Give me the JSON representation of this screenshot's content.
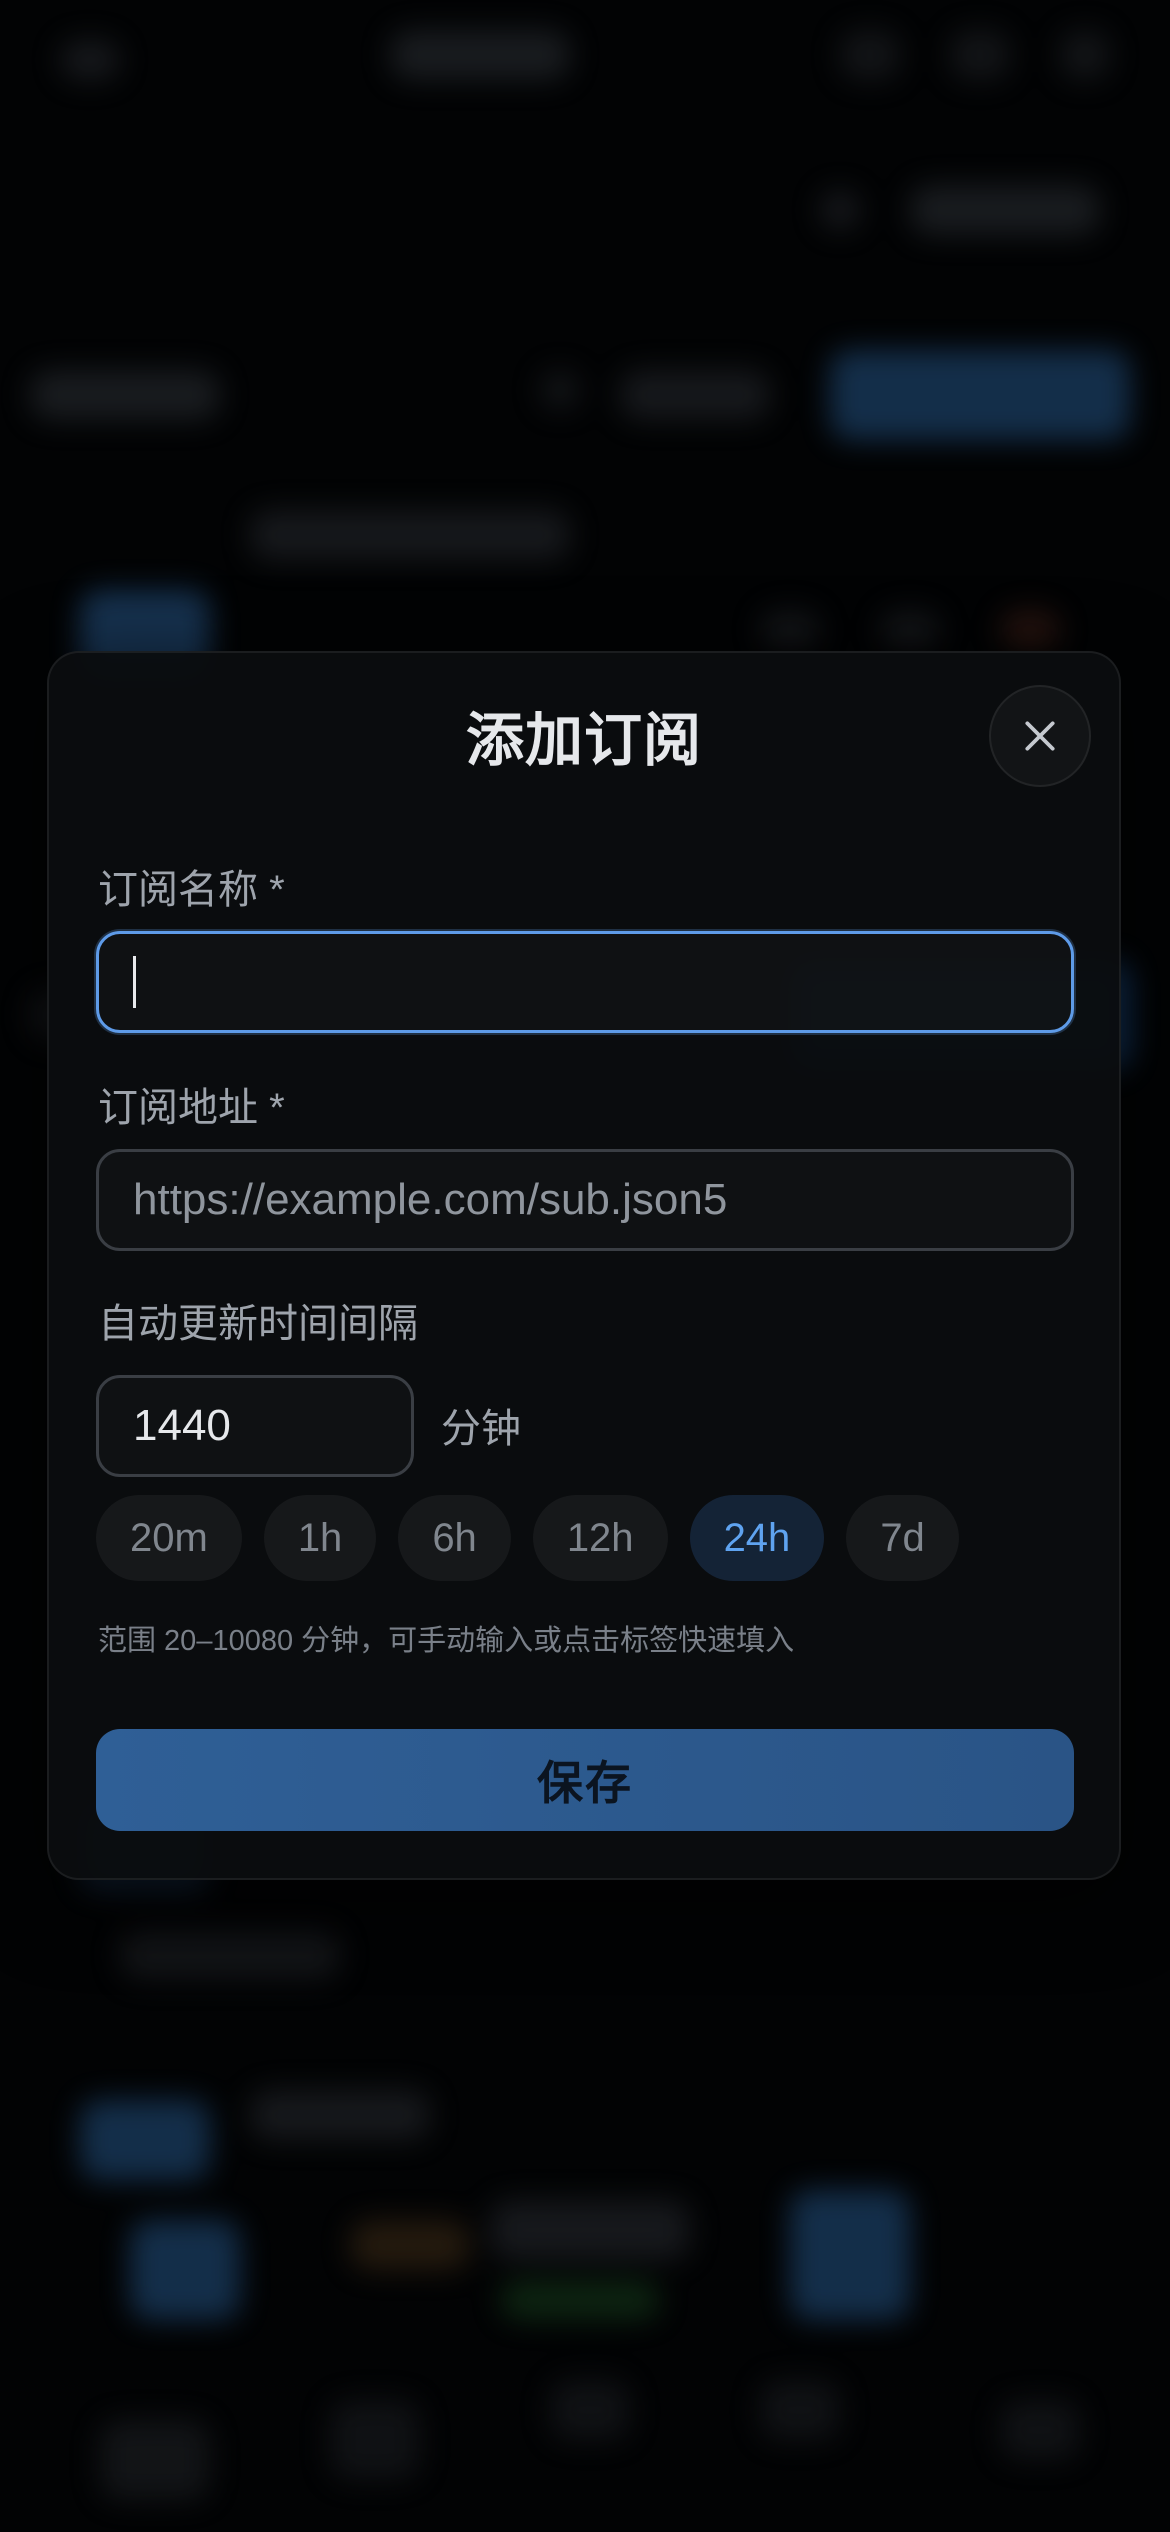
{
  "modal": {
    "title": "添加订阅",
    "close_icon": "close-icon"
  },
  "fields": {
    "name": {
      "label": "订阅名称 *",
      "value": "",
      "placeholder": ""
    },
    "url": {
      "label": "订阅地址 *",
      "value": "",
      "placeholder": "https://example.com/sub.json5"
    },
    "interval": {
      "label": "自动更新时间间隔",
      "value": "1440",
      "unit": "分钟"
    }
  },
  "presets": [
    {
      "label": "20m",
      "active": false
    },
    {
      "label": "1h",
      "active": false
    },
    {
      "label": "6h",
      "active": false
    },
    {
      "label": "12h",
      "active": false
    },
    {
      "label": "24h",
      "active": true
    },
    {
      "label": "7d",
      "active": false
    }
  ],
  "hint": "范围 20–10080 分钟，可手动输入或点击标签快速填入",
  "save_label": "保存",
  "colors": {
    "accent": "#5fa3f0",
    "button": "#2f5f96",
    "focus_border": "#5e9be8"
  }
}
